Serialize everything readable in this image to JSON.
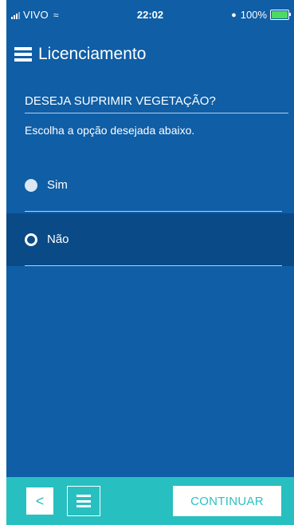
{
  "status_bar": {
    "carrier": "VIVO",
    "time": "22:02",
    "battery": "100%"
  },
  "header": {
    "title": "Licenciamento"
  },
  "question": {
    "title": "DESEJA SUPRIMIR VEGETAÇÃO?",
    "subtitle": "Escolha a opção desejada abaixo."
  },
  "options": [
    {
      "label": "Sim",
      "selected": false
    },
    {
      "label": "Não",
      "selected": true
    }
  ],
  "footer": {
    "back_label": "<",
    "continue_label": "CONTINUAR"
  },
  "colors": {
    "background": "#0f5ea6",
    "selected_row": "#0a4a86",
    "footer": "#28bfc0"
  }
}
